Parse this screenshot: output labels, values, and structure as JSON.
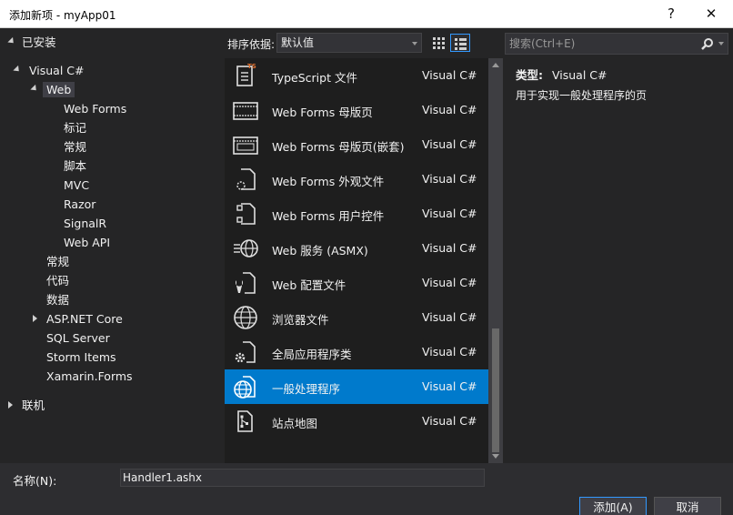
{
  "window": {
    "title": "添加新项 - myApp01",
    "help_glyph": "?",
    "close_glyph": "✕"
  },
  "tree": {
    "installed_label": "已安装",
    "visual_csharp": "Visual C#",
    "web": "Web",
    "web_children": [
      "Web Forms",
      "标记",
      "常规",
      "脚本",
      "MVC",
      "Razor",
      "SignalR",
      "Web API"
    ],
    "csharp_children": [
      "常规",
      "代码",
      "数据",
      "ASP.NET Core",
      "SQL Server",
      "Storm Items",
      "Xamarin.Forms"
    ],
    "online_label": "联机"
  },
  "toolbar": {
    "sort_label": "排序依据:",
    "sort_value": "默认值",
    "search_placeholder": "搜索(Ctrl+E)"
  },
  "templates": [
    {
      "name": "TypeScript 文件",
      "lang": "Visual C#",
      "icon": "typescript-file-icon"
    },
    {
      "name": "Web Forms 母版页",
      "lang": "Visual C#",
      "icon": "master-page-icon"
    },
    {
      "name": "Web Forms 母版页(嵌套)",
      "lang": "Visual C#",
      "icon": "nested-master-page-icon"
    },
    {
      "name": "Web Forms 外观文件",
      "lang": "Visual C#",
      "icon": "skin-file-icon"
    },
    {
      "name": "Web Forms 用户控件",
      "lang": "Visual C#",
      "icon": "user-control-icon"
    },
    {
      "name": "Web 服务 (ASMX)",
      "lang": "Visual C#",
      "icon": "web-service-icon"
    },
    {
      "name": "Web 配置文件",
      "lang": "Visual C#",
      "icon": "web-config-icon"
    },
    {
      "name": "浏览器文件",
      "lang": "Visual C#",
      "icon": "browser-file-icon"
    },
    {
      "name": "全局应用程序类",
      "lang": "Visual C#",
      "icon": "global-app-class-icon"
    },
    {
      "name": "一般处理程序",
      "lang": "Visual C#",
      "icon": "generic-handler-icon",
      "selected": true
    },
    {
      "name": "站点地图",
      "lang": "Visual C#",
      "icon": "sitemap-icon"
    }
  ],
  "description": {
    "type_label": "类型:",
    "type_value": "Visual C#",
    "text": "用于实现一般处理程序的页"
  },
  "footer": {
    "name_label": "名称(N):",
    "name_value": "Handler1.ashx",
    "add_button": "添加(A)",
    "cancel_button": "取消"
  },
  "colors": {
    "selection": "#007acc",
    "background": "#252526",
    "list_background": "#1e1e1e"
  }
}
